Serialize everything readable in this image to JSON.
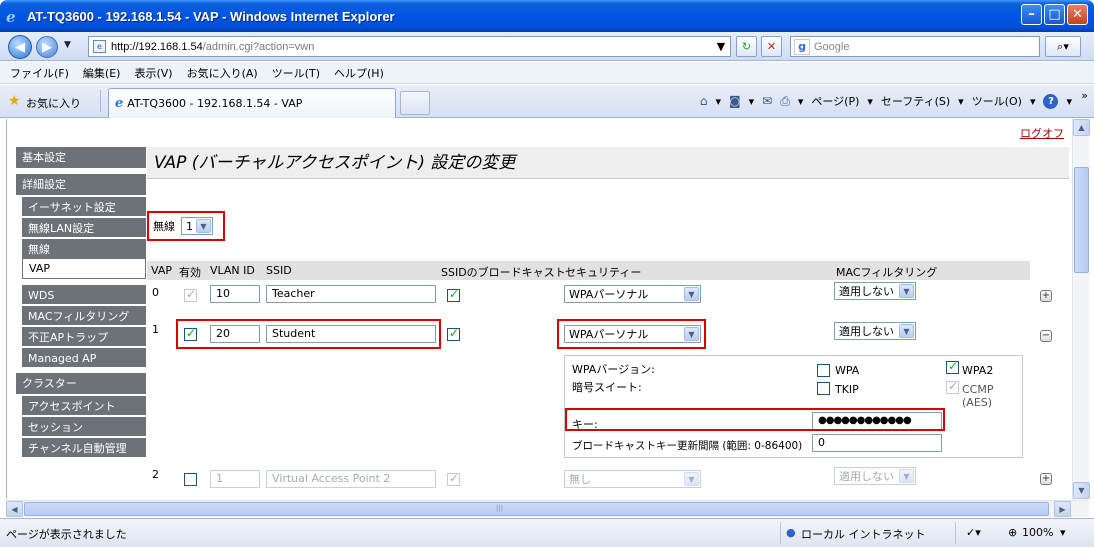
{
  "window": {
    "title": "AT-TQ3600 - 192.168.1.54 - VAP - Windows Internet Explorer",
    "min_glyph": "–",
    "max_glyph": "□",
    "close_glyph": "✕"
  },
  "address": {
    "url_host": "http://192.168.1.54",
    "url_path": "/admin.cgi?action=vwn",
    "search_placeholder": "Google",
    "refresh_glyph": "↻",
    "stop_glyph": "✕",
    "search_glyph": "⌕"
  },
  "menu": [
    "ファイル(F)",
    "編集(E)",
    "表示(V)",
    "お気に入り(A)",
    "ツール(T)",
    "ヘルプ(H)"
  ],
  "favbar": {
    "favorites_label": "お気に入り",
    "tab_title": "AT-TQ3600 - 192.168.1.54 - VAP",
    "home_icon": "⌂",
    "feeds_icon": "◙",
    "mail_icon": "✉",
    "print_icon": "⎙",
    "page_label": "ページ(P)",
    "safety_label": "セーフティ(S)",
    "tools_label": "ツール(O)",
    "help_icon": "?"
  },
  "page": {
    "logoff": "ログオフ",
    "title": "VAP (バーチャルアクセスポイント) 設定の変更",
    "radio_label": "無線",
    "radio_value": "1"
  },
  "nav": {
    "basic": "基本設定",
    "advanced": "詳細設定",
    "ethernet": "イーサネット設定",
    "wlan": "無線LAN設定",
    "wireless": "無線",
    "vap": "VAP",
    "wds": "WDS",
    "mac_filter": "MACフィルタリング",
    "rogue_ap": "不正APトラップ",
    "managed_ap": "Managed AP",
    "cluster": "クラスター",
    "access_points": "アクセスポイント",
    "sessions": "セッション",
    "channel_mgmt": "チャンネル自動管理"
  },
  "table": {
    "headers": {
      "vap": "VAP",
      "enabled": "有効",
      "vlan": "VLAN ID",
      "ssid": "SSID",
      "broadcast": "SSIDのブロードキャスト",
      "security": "セキュリティー",
      "mac": "MACフィルタリング"
    },
    "rows": [
      {
        "num": "0",
        "vlan": "10",
        "ssid": "Teacher",
        "security": "WPAパーソナル",
        "mac": "適用しない",
        "expand": "+"
      },
      {
        "num": "1",
        "vlan": "20",
        "ssid": "Student",
        "security": "WPAパーソナル",
        "mac": "適用しない",
        "expand": "−"
      },
      {
        "num": "2",
        "vlan": "1",
        "ssid": "Virtual Access Point 2",
        "security": "無し",
        "mac": "適用しない",
        "expand": "+"
      }
    ]
  },
  "wpa": {
    "version_label": "WPAバージョン:",
    "wpa": "WPA",
    "wpa2": "WPA2",
    "cipher_label": "暗号スイート:",
    "tkip": "TKIP",
    "ccmp": "CCMP (AES)",
    "key_label": "キー:",
    "key_value": "●●●●●●●●●●●●",
    "rekey_label": "ブロードキャストキー更新間隔 (範囲: 0-86400)",
    "rekey_value": "0"
  },
  "status": {
    "text": "ページが表示されました",
    "zone": "ローカル イントラネット",
    "zoom": "100%"
  }
}
